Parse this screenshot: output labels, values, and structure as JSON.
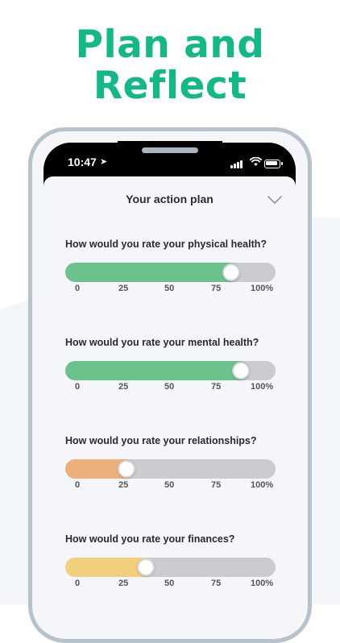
{
  "headline": {
    "line1": "Plan and",
    "line2": "Reflect"
  },
  "status_bar": {
    "time": "10:47",
    "location_arrow": "➤"
  },
  "sheet": {
    "title": "Your action plan"
  },
  "questions": [
    {
      "label": "How would you rate your physical health?",
      "value": 82,
      "color": "#6cc28c"
    },
    {
      "label": "How would you rate your mental health?",
      "value": 87,
      "color": "#6cc28c"
    },
    {
      "label": "How would you rate your relationships?",
      "value": 27,
      "color": "#eeb07a"
    },
    {
      "label": "How would you rate your finances?",
      "value": 37,
      "color": "#f2cf7c"
    }
  ],
  "ticks": [
    "0",
    "25",
    "50",
    "75",
    "100%"
  ],
  "colors": {
    "brand": "#12b886",
    "track": "#cbcbd0"
  },
  "icons": [
    "location-arrow-icon",
    "signal-icon",
    "wifi-icon",
    "battery-icon",
    "chevron-down-icon"
  ]
}
